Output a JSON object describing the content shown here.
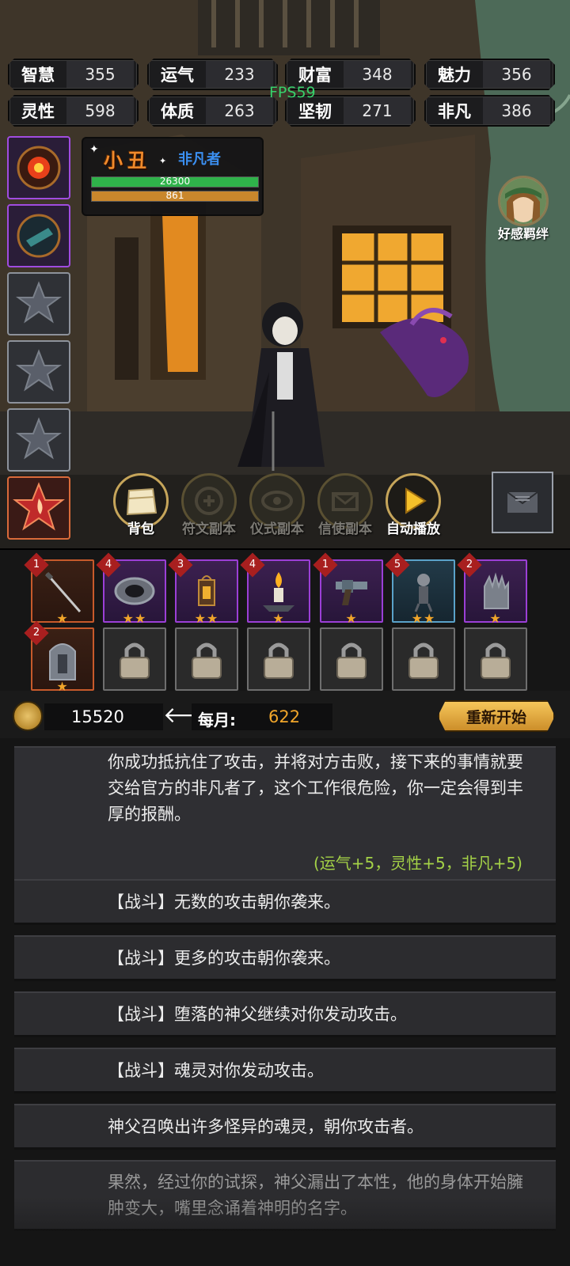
{
  "stats": [
    {
      "label": "智慧",
      "value": "355"
    },
    {
      "label": "运气",
      "value": "233"
    },
    {
      "label": "财富",
      "value": "348"
    },
    {
      "label": "魅力",
      "value": "356"
    },
    {
      "label": "灵性",
      "value": "598"
    },
    {
      "label": "体质",
      "value": "263"
    },
    {
      "label": "坚韧",
      "value": "271"
    },
    {
      "label": "非凡",
      "value": "386"
    }
  ],
  "fps": "FPS59",
  "character": {
    "name": "小丑",
    "class": "非凡者",
    "hp": "26300",
    "hp_fraction": 1.0,
    "mp": "861",
    "mp_fraction": 1.0
  },
  "affinity_label": "好感羁绊",
  "skill_slots": [
    {
      "icon": "sun-eye-icon",
      "state": "active"
    },
    {
      "icon": "compass-scroll-icon",
      "state": "active"
    },
    {
      "icon": "empty-star-icon",
      "state": "empty"
    },
    {
      "icon": "empty-star-icon",
      "state": "empty"
    },
    {
      "icon": "empty-star-icon",
      "state": "empty"
    },
    {
      "icon": "flame-star-icon",
      "state": "special"
    }
  ],
  "actions": [
    {
      "label": "背包",
      "icon": "backpack-icon",
      "enabled": true
    },
    {
      "label": "符文副本",
      "icon": "rune-icon",
      "enabled": false
    },
    {
      "label": "仪式副本",
      "icon": "ritual-eye-icon",
      "enabled": false
    },
    {
      "label": "信使副本",
      "icon": "envelope-wing-icon",
      "enabled": false
    },
    {
      "label": "自动播放",
      "icon": "play-icon",
      "enabled": true
    }
  ],
  "mail_icon": "mail-icon",
  "items": [
    {
      "level": "1",
      "stars": 1,
      "rarity": "orange",
      "icon": "cane-sword-icon"
    },
    {
      "level": "4",
      "stars": 2,
      "rarity": "purple",
      "icon": "eye-ring-icon"
    },
    {
      "level": "3",
      "stars": 2,
      "rarity": "purple",
      "icon": "lantern-icon"
    },
    {
      "level": "4",
      "stars": 1,
      "rarity": "purple",
      "icon": "candle-icon"
    },
    {
      "level": "1",
      "stars": 1,
      "rarity": "purple",
      "icon": "revolver-icon"
    },
    {
      "level": "5",
      "stars": 2,
      "rarity": "blue",
      "icon": "puppet-icon"
    },
    {
      "level": "2",
      "stars": 1,
      "rarity": "purple",
      "icon": "gauntlet-icon"
    },
    {
      "level": "2",
      "stars": 1,
      "rarity": "orange",
      "icon": "tombstone-icon"
    },
    {
      "locked": true,
      "icon": "lock-icon"
    },
    {
      "locked": true,
      "icon": "lock-icon"
    },
    {
      "locked": true,
      "icon": "lock-icon"
    },
    {
      "locked": true,
      "icon": "lock-icon"
    },
    {
      "locked": true,
      "icon": "lock-icon"
    },
    {
      "locked": true,
      "icon": "lock-icon"
    }
  ],
  "currency": {
    "gold": "15520",
    "monthly_label": "每月:",
    "monthly_value": "622",
    "restart_label": "重新开始"
  },
  "log": {
    "main": "你成功抵抗住了攻击，并将对方击败，接下来的事情就要交给官方的非凡者了，这个工作很危险，你一定会得到丰厚的报酬。",
    "reward": "(运气+5，灵性+5，非凡+5)",
    "entries": [
      "【战斗】无数的攻击朝你袭来。",
      "【战斗】更多的攻击朝你袭来。",
      "【战斗】堕落的神父继续对你发动攻击。",
      "【战斗】魂灵对你发动攻击。",
      "神父召唤出许多怪异的魂灵，朝你攻击者。",
      "果然，经过你的试探，神父漏出了本性，他的身体开始臃肿变大，嘴里念诵着神明的名字。"
    ]
  },
  "colors": {
    "accent_gold": "#f0a52a",
    "reward_green": "#a4d247",
    "hp_green": "#2fb24a",
    "mp_orange": "#c9872c",
    "class_blue": "#3b8ff0",
    "name_orange": "#f08a2b"
  }
}
